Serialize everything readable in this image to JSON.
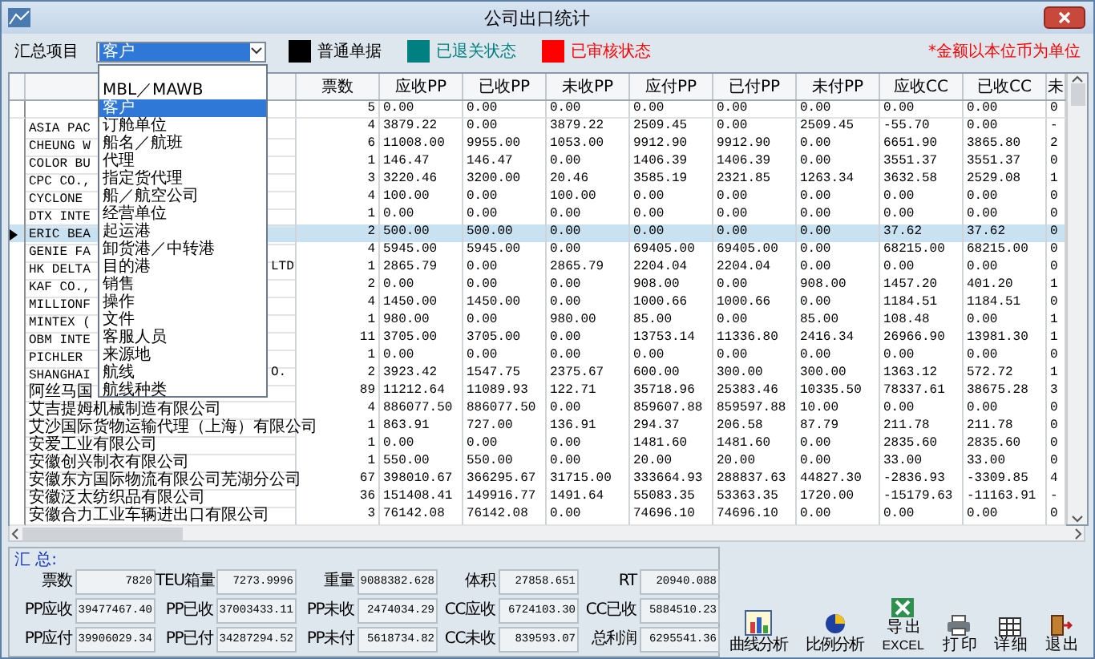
{
  "window": {
    "title": "公司出口统计"
  },
  "toolbar": {
    "group_label": "汇总项目",
    "group_value": "客户",
    "legend": [
      {
        "label": "普通单据",
        "color": "#000000"
      },
      {
        "label": "已退关状态",
        "color": "#008080"
      },
      {
        "label": "已审核状态",
        "color": "#ff0000"
      }
    ],
    "note": "*金额以本位币为单位"
  },
  "dropdown": {
    "options": [
      {
        "label": "MBL／MAWB",
        "selected": false
      },
      {
        "label": "客户",
        "selected": true
      },
      {
        "label": "订舱单位",
        "selected": false
      },
      {
        "label": "船名／航班",
        "selected": false
      },
      {
        "label": "代理",
        "selected": false
      },
      {
        "label": "指定货代理",
        "selected": false
      },
      {
        "label": "船／航空公司",
        "selected": false
      },
      {
        "label": "经营单位",
        "selected": false
      },
      {
        "label": "起运港",
        "selected": false
      },
      {
        "label": "卸货港／中转港",
        "selected": false
      },
      {
        "label": "目的港",
        "selected": false
      },
      {
        "label": "销售",
        "selected": false
      },
      {
        "label": "操作",
        "selected": false
      },
      {
        "label": "文件",
        "selected": false
      },
      {
        "label": "客服人员",
        "selected": false
      },
      {
        "label": "来源地",
        "selected": false
      },
      {
        "label": "航线",
        "selected": false
      },
      {
        "label": "航线种类",
        "selected": false
      }
    ]
  },
  "table": {
    "columns": [
      "票数",
      "应收PP",
      "已收PP",
      "未收PP",
      "应付PP",
      "已付PP",
      "未付PP",
      "应收CC",
      "已收CC",
      "未"
    ],
    "rows": [
      {
        "values": [
          "5",
          "0.00",
          "0.00",
          "0.00",
          "0.00",
          "0.00",
          "0.00",
          "0.00",
          "0.00",
          "0"
        ],
        "selected": false
      },
      {
        "name": "ASIA PAC",
        "values": [
          "4",
          "3879.22",
          "0.00",
          "3879.22",
          "2509.45",
          "0.00",
          "2509.45",
          "-55.70",
          "0.00",
          "-"
        ],
        "selected": false
      },
      {
        "name": "CHEUNG W",
        "values": [
          "6",
          "11008.00",
          "9955.00",
          "1053.00",
          "9912.90",
          "9912.90",
          "0.00",
          "6651.90",
          "3865.80",
          "2"
        ],
        "selected": false
      },
      {
        "name": "COLOR BU",
        "values": [
          "1",
          "146.47",
          "146.47",
          "0.00",
          "1406.39",
          "1406.39",
          "0.00",
          "3551.37",
          "3551.37",
          "0"
        ],
        "selected": false
      },
      {
        "name": "CPC CO.,",
        "values": [
          "3",
          "3220.46",
          "3200.00",
          "20.46",
          "3585.19",
          "2321.85",
          "1263.34",
          "3632.58",
          "2529.08",
          "1"
        ],
        "selected": false
      },
      {
        "name": "CYCLONE",
        "values": [
          "4",
          "100.00",
          "0.00",
          "100.00",
          "0.00",
          "0.00",
          "0.00",
          "0.00",
          "0.00",
          "0"
        ],
        "selected": false
      },
      {
        "name": "DTX INTE",
        "values": [
          "1",
          "0.00",
          "0.00",
          "0.00",
          "0.00",
          "0.00",
          "0.00",
          "0.00",
          "0.00",
          "0"
        ],
        "selected": false
      },
      {
        "name": "ERIC BEA",
        "values": [
          "2",
          "500.00",
          "500.00",
          "0.00",
          "0.00",
          "0.00",
          "0.00",
          "37.62",
          "37.62",
          "0"
        ],
        "selected": true
      },
      {
        "name": "GENIE FA",
        "values": [
          "4",
          "5945.00",
          "5945.00",
          "0.00",
          "69405.00",
          "69405.00",
          "0.00",
          "68215.00",
          "68215.00",
          "0"
        ],
        "selected": false
      },
      {
        "name": "HK DELTA",
        "tail": "LTD",
        "values": [
          "1",
          "2865.79",
          "0.00",
          "2865.79",
          "2204.04",
          "2204.04",
          "0.00",
          "0.00",
          "0.00",
          "0"
        ],
        "selected": false
      },
      {
        "name": "KAF CO.,",
        "values": [
          "2",
          "0.00",
          "0.00",
          "0.00",
          "908.00",
          "0.00",
          "908.00",
          "1457.20",
          "401.20",
          "1"
        ],
        "selected": false
      },
      {
        "name": "MILLIONF",
        "values": [
          "4",
          "1450.00",
          "1450.00",
          "0.00",
          "1000.66",
          "1000.66",
          "0.00",
          "1184.51",
          "1184.51",
          "0"
        ],
        "selected": false
      },
      {
        "name": "MINTEX (",
        "values": [
          "1",
          "980.00",
          "0.00",
          "980.00",
          "85.00",
          "0.00",
          "85.00",
          "108.48",
          "0.00",
          "1"
        ],
        "selected": false
      },
      {
        "name": "OBM INTE",
        "values": [
          "11",
          "3705.00",
          "3705.00",
          "0.00",
          "13753.14",
          "11336.80",
          "2416.34",
          "26966.90",
          "13981.30",
          "1"
        ],
        "selected": false
      },
      {
        "name": "PICHLER",
        "values": [
          "1",
          "0.00",
          "0.00",
          "0.00",
          "0.00",
          "0.00",
          "0.00",
          "0.00",
          "0.00",
          "0"
        ],
        "selected": false
      },
      {
        "name": "SHANGHAI",
        "tail": "O.",
        "values": [
          "2",
          "3923.42",
          "1547.75",
          "2375.67",
          "600.00",
          "300.00",
          "300.00",
          "1363.12",
          "572.72",
          "1"
        ],
        "selected": false
      },
      {
        "name": "阿丝马国",
        "values": [
          "89",
          "11212.64",
          "11089.93",
          "122.71",
          "35718.96",
          "25383.46",
          "10335.50",
          "78337.61",
          "38675.28",
          "3"
        ],
        "selected": false
      },
      {
        "name": "艾吉提姆机械制造有限公司",
        "values": [
          "4",
          "886077.50",
          "886077.50",
          "0.00",
          "859607.88",
          "859597.88",
          "10.00",
          "0.00",
          "0.00",
          "0"
        ],
        "selected": false
      },
      {
        "name": "艾沙国际货物运输代理（上海）有限公司",
        "values": [
          "1",
          "863.91",
          "727.00",
          "136.91",
          "294.37",
          "206.58",
          "87.79",
          "211.78",
          "211.78",
          "0"
        ],
        "selected": false
      },
      {
        "name": "安爱工业有限公司",
        "values": [
          "1",
          "0.00",
          "0.00",
          "0.00",
          "1481.60",
          "1481.60",
          "0.00",
          "2835.60",
          "2835.60",
          "0"
        ],
        "selected": false
      },
      {
        "name": "安徽创兴制衣有限公司",
        "values": [
          "1",
          "550.00",
          "550.00",
          "0.00",
          "20.00",
          "20.00",
          "0.00",
          "33.00",
          "33.00",
          "0"
        ],
        "selected": false
      },
      {
        "name": "安徽东方国际物流有限公司芜湖分公司",
        "values": [
          "67",
          "398010.67",
          "366295.67",
          "31715.00",
          "333664.93",
          "288837.63",
          "44827.30",
          "-2836.93",
          "-3309.85",
          "4"
        ],
        "selected": false
      },
      {
        "name": "安徽泛太纺织品有限公司",
        "values": [
          "36",
          "151408.41",
          "149916.77",
          "1491.64",
          "55083.35",
          "53363.35",
          "1720.00",
          "-15179.63",
          "-11163.91",
          "-"
        ],
        "selected": false
      },
      {
        "name": "安徽合力工业车辆进出口有限公司",
        "values": [
          "3",
          "76142.08",
          "76142.08",
          "0.00",
          "74696.10",
          "74696.10",
          "0.00",
          "0.00",
          "0.00",
          "0"
        ],
        "selected": false
      }
    ]
  },
  "summary": {
    "title": "汇 总:",
    "fields": [
      {
        "label": "票数",
        "value": "7820"
      },
      {
        "label": "TEU箱量",
        "value": "7273.9996"
      },
      {
        "label": "重量",
        "value": "9088382.628"
      },
      {
        "label": "体积",
        "value": "27858.651"
      },
      {
        "label": "RT",
        "value": "20940.088"
      },
      {
        "label": "PP应收",
        "value": "39477467.40"
      },
      {
        "label": "PP已收",
        "value": "37003433.11"
      },
      {
        "label": "PP未收",
        "value": "2474034.29"
      },
      {
        "label": "CC应收",
        "value": "6724103.30"
      },
      {
        "label": "CC已收",
        "value": "5884510.23"
      },
      {
        "label": "PP应付",
        "value": "39906029.34"
      },
      {
        "label": "PP已付",
        "value": "34287294.52"
      },
      {
        "label": "PP未付",
        "value": "5618734.82"
      },
      {
        "label": "CC未收",
        "value": "839593.07"
      },
      {
        "label": "总利润",
        "value": "6295541.36"
      }
    ]
  },
  "buttons": [
    {
      "kind": "chart",
      "label": "曲线分析"
    },
    {
      "kind": "ratio",
      "label": "比例分析"
    },
    {
      "kind": "excel",
      "label": "导 出",
      "sublabel": "EXCEL"
    },
    {
      "kind": "print",
      "label": "打 印"
    },
    {
      "kind": "detail",
      "label": "详 细"
    },
    {
      "kind": "exit",
      "label": "退 出"
    }
  ]
}
